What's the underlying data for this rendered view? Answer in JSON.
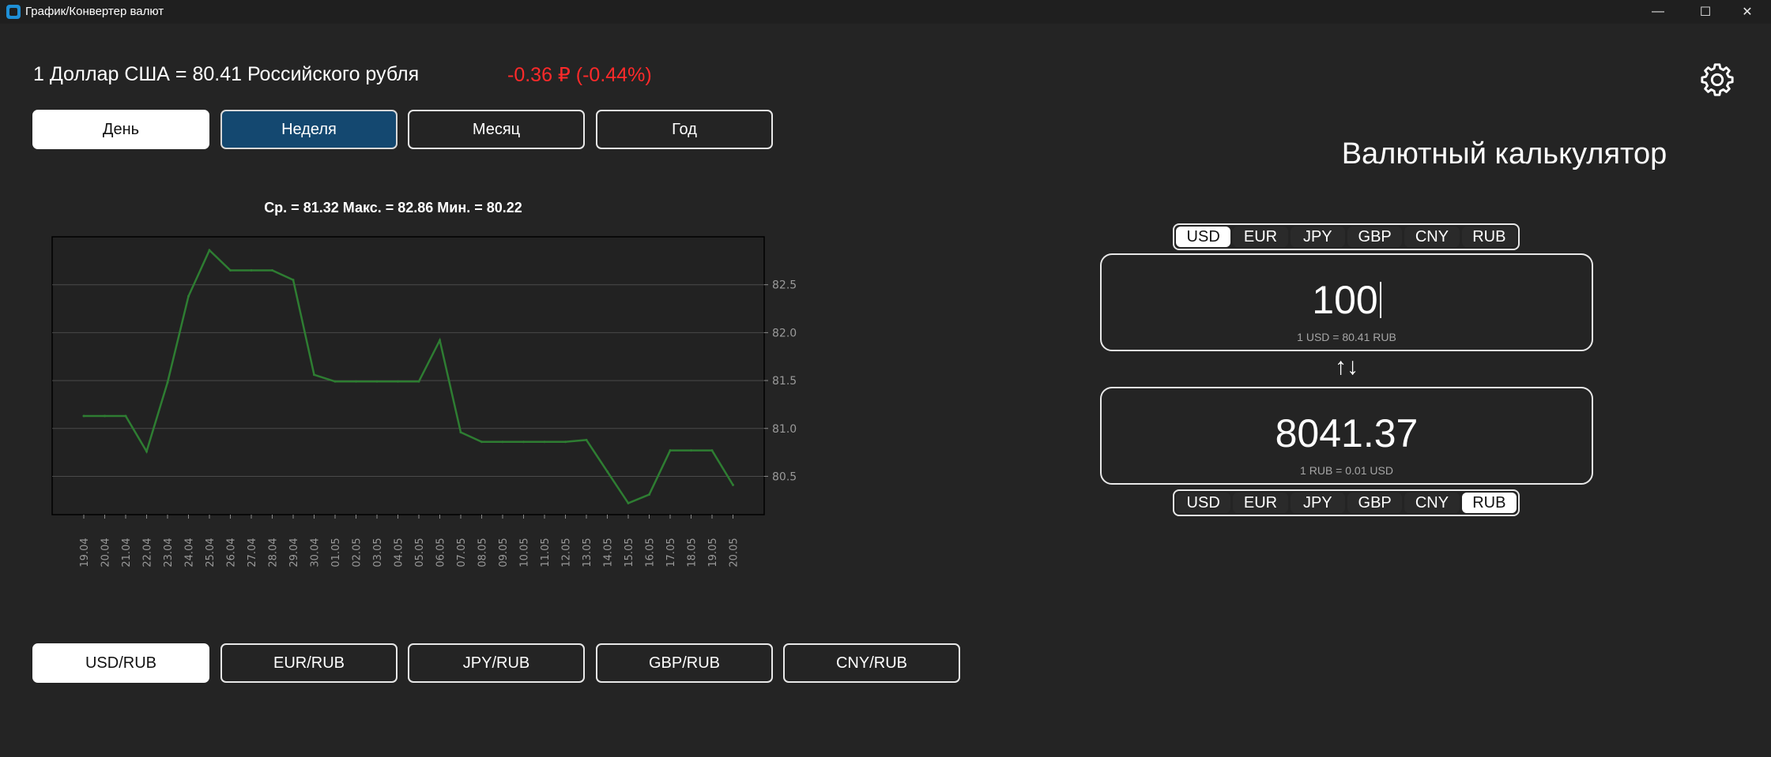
{
  "window": {
    "title": "График/Конвертер валют",
    "minimize_icon": "—",
    "maximize_icon": "☐",
    "close_icon": "✕"
  },
  "rate": {
    "text": "1 Доллар США = 80.41 Российского рубля",
    "change": "-0.36 ₽ (-0.44%)",
    "change_color": "#ff2a2a"
  },
  "period_buttons": [
    {
      "label": "День",
      "state": "selected"
    },
    {
      "label": "Неделя",
      "state": "highlight"
    },
    {
      "label": "Месяц",
      "state": "normal"
    },
    {
      "label": "Год",
      "state": "normal"
    }
  ],
  "pair_buttons": [
    {
      "label": "USD/RUB",
      "state": "selected"
    },
    {
      "label": "EUR/RUB",
      "state": "normal"
    },
    {
      "label": "JPY/RUB",
      "state": "normal"
    },
    {
      "label": "GBP/RUB",
      "state": "normal"
    },
    {
      "label": "CNY/RUB",
      "state": "normal"
    }
  ],
  "chart_data": {
    "type": "line",
    "title": "Ср. = 81.32  Макс. = 82.86  Мин. = 80.22",
    "categories": [
      "19.04",
      "20.04",
      "21.04",
      "22.04",
      "23.04",
      "24.04",
      "25.04",
      "26.04",
      "27.04",
      "28.04",
      "29.04",
      "30.04",
      "01.05",
      "02.05",
      "03.05",
      "04.05",
      "05.05",
      "06.05",
      "07.05",
      "08.05",
      "09.05",
      "10.05",
      "11.05",
      "12.05",
      "13.05",
      "14.05",
      "15.05",
      "16.05",
      "17.05",
      "18.05",
      "19.05",
      "20.05"
    ],
    "values": [
      81.13,
      81.13,
      81.13,
      80.76,
      81.48,
      82.38,
      82.86,
      82.65,
      82.65,
      82.65,
      82.55,
      81.56,
      81.49,
      81.49,
      81.49,
      81.49,
      81.49,
      81.92,
      80.96,
      80.86,
      80.86,
      80.86,
      80.86,
      80.86,
      80.88,
      80.55,
      80.22,
      80.31,
      80.77,
      80.77,
      80.77,
      80.41
    ],
    "yticks": [
      80.5,
      81.0,
      81.5,
      82.0,
      82.5
    ],
    "ylim": [
      80.1,
      83.0
    ],
    "y_axis_position": "right",
    "grid": "horizontal",
    "line_color": "#2e7d32",
    "xlabel": "",
    "ylabel": ""
  },
  "calculator": {
    "title": "Валютный калькулятор",
    "currencies": [
      "USD",
      "EUR",
      "JPY",
      "GBP",
      "CNY",
      "RUB"
    ],
    "from_currency": "USD",
    "to_currency": "RUB",
    "from_value": "100",
    "from_rate": "1 USD = 80.41 RUB",
    "to_value": "8041.37",
    "to_rate": "1 RUB = 0.01 USD",
    "swap_icon": "↑↓"
  },
  "icons": {
    "settings": "gear-icon",
    "swap": "swap-arrows-icon"
  }
}
